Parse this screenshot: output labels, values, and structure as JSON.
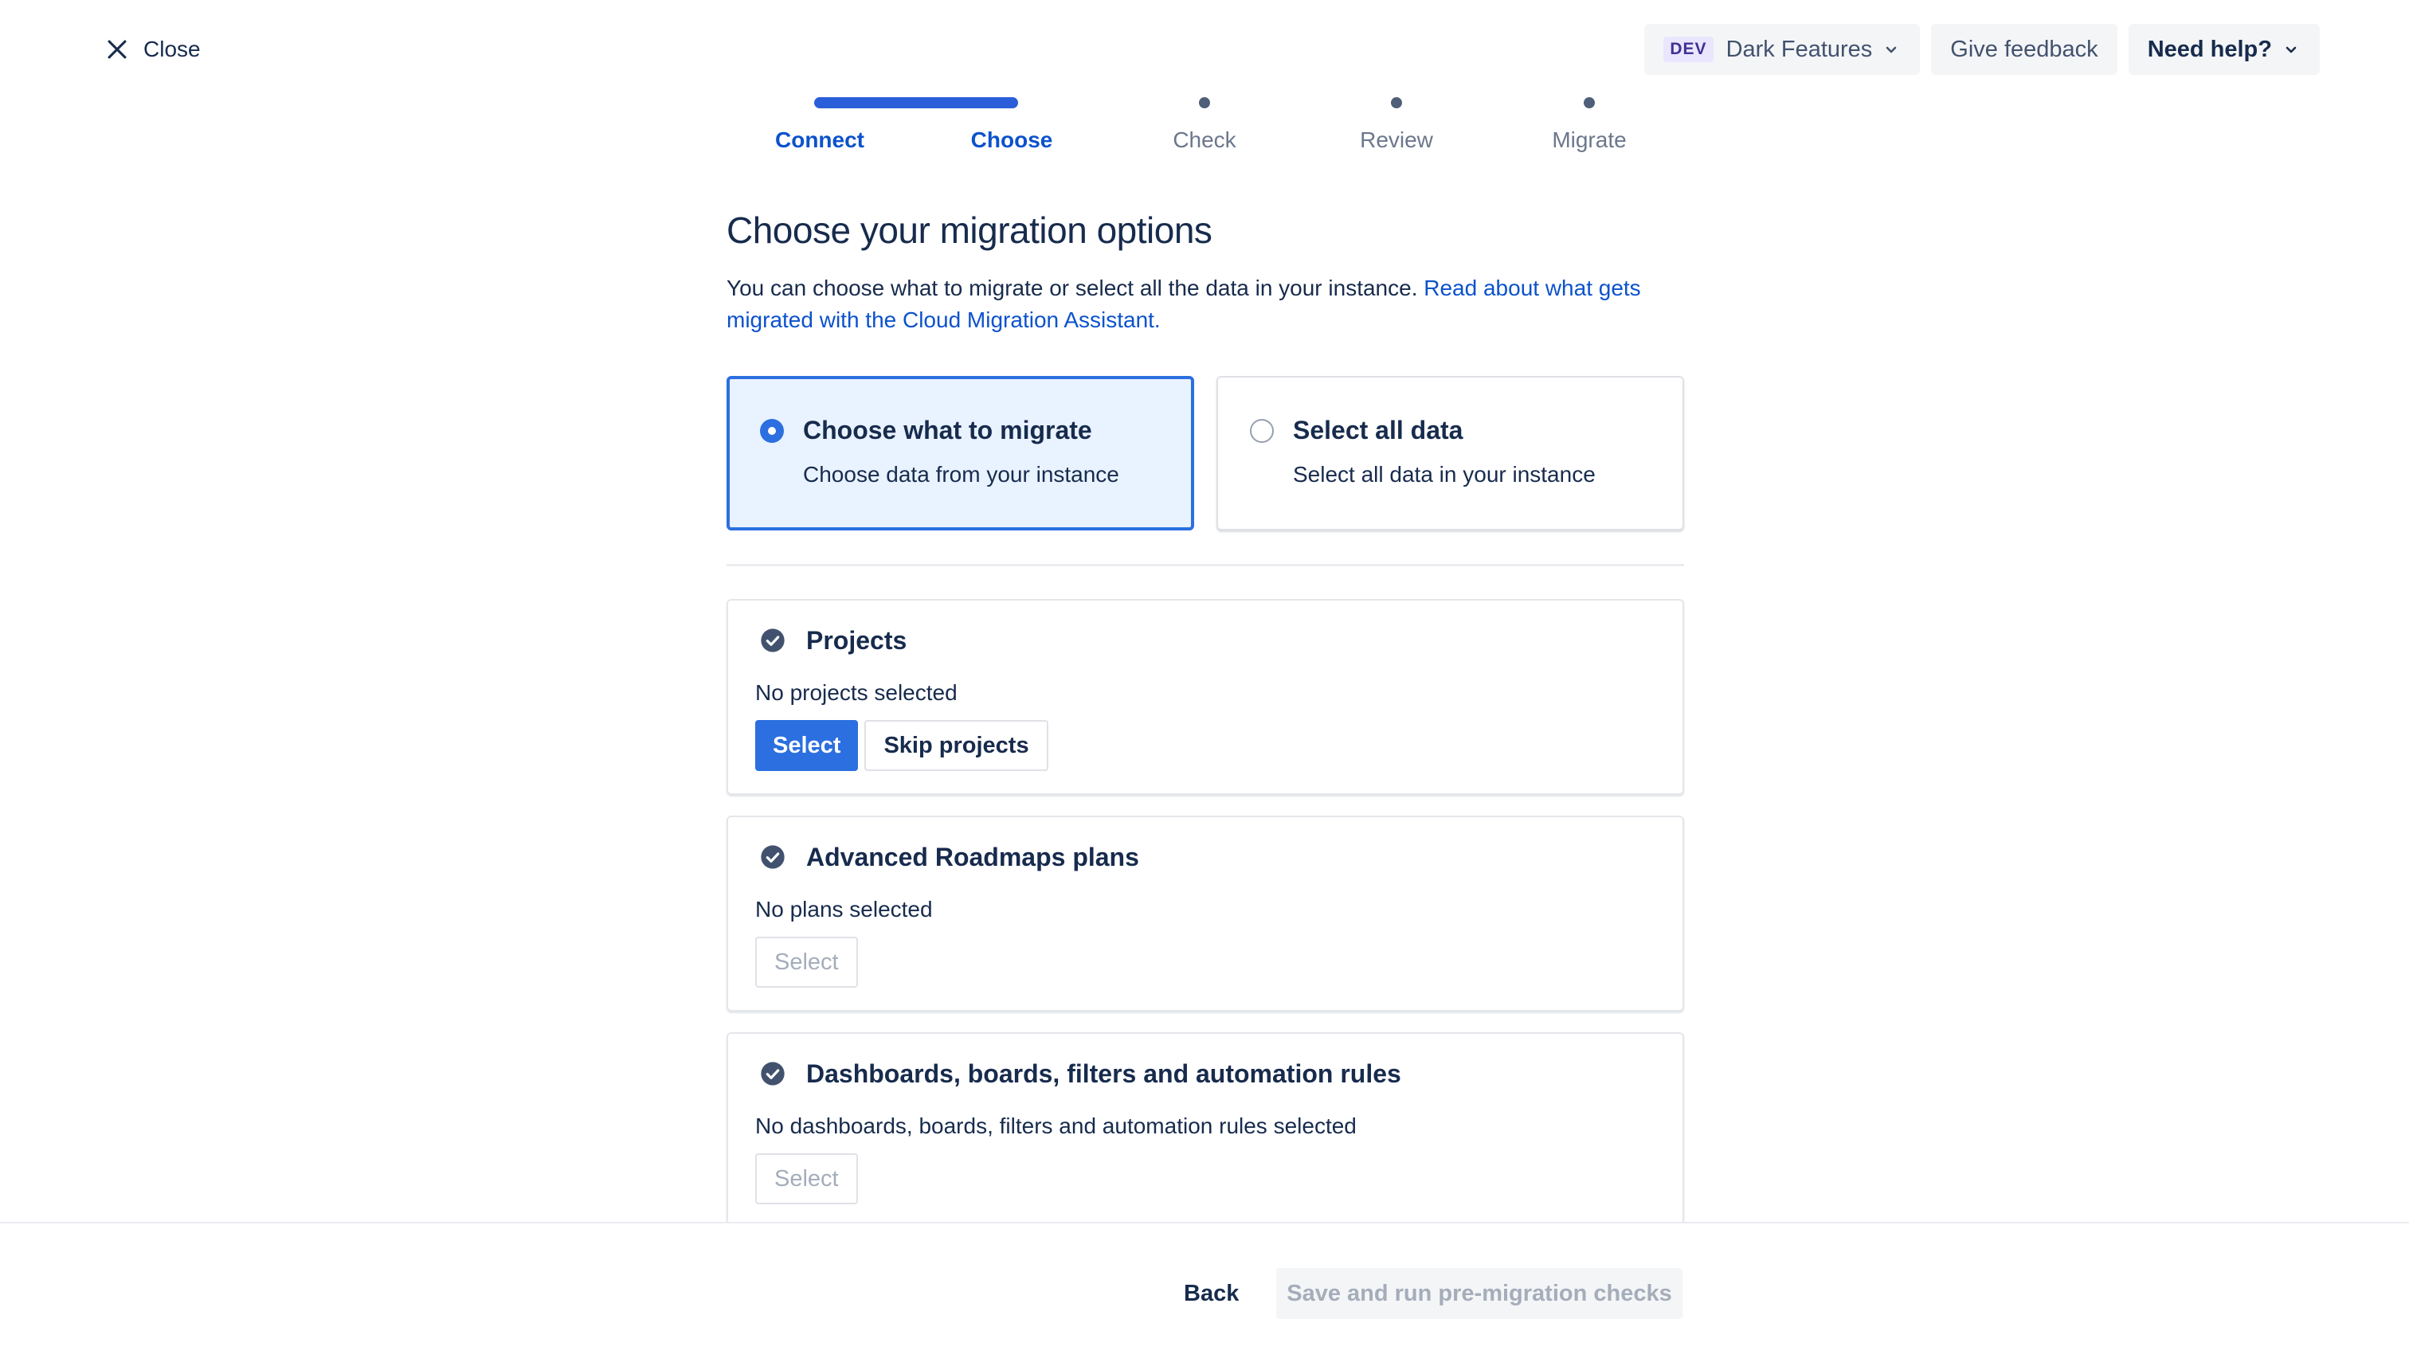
{
  "header": {
    "close_label": "Close",
    "dev_badge": "DEV",
    "dark_features_label": "Dark Features",
    "give_feedback_label": "Give feedback",
    "need_help_label": "Need help?"
  },
  "steps": [
    {
      "label": "Connect",
      "state": "complete"
    },
    {
      "label": "Choose",
      "state": "current"
    },
    {
      "label": "Check",
      "state": "upcoming"
    },
    {
      "label": "Review",
      "state": "upcoming"
    },
    {
      "label": "Migrate",
      "state": "upcoming"
    }
  ],
  "main": {
    "title": "Choose your migration options",
    "intro_text": "You can choose what to migrate or select all the data in your instance. ",
    "intro_link": "Read about what gets migrated with the Cloud Migration Assistant.",
    "options": [
      {
        "title": "Choose what to migrate",
        "description": "Choose data from your instance",
        "selected": true
      },
      {
        "title": "Select all data",
        "description": "Select all data in your instance",
        "selected": false
      }
    ]
  },
  "cards": [
    {
      "title": "Projects",
      "status": "No projects selected",
      "select_label": "Select",
      "skip_label": "Skip projects"
    },
    {
      "title": "Advanced Roadmaps plans",
      "status": "No plans selected",
      "select_label": "Select"
    },
    {
      "title": "Dashboards, boards, filters and automation rules",
      "status": "No dashboards, boards, filters and automation rules selected",
      "select_label": "Select"
    }
  ],
  "footer": {
    "back_label": "Back",
    "run_checks_label": "Save and run pre-migration checks"
  },
  "colors": {
    "primary": "#2b6fe0",
    "link": "#0c52cc",
    "text": "#172b4d",
    "selected_bg": "#e9f2ff"
  }
}
